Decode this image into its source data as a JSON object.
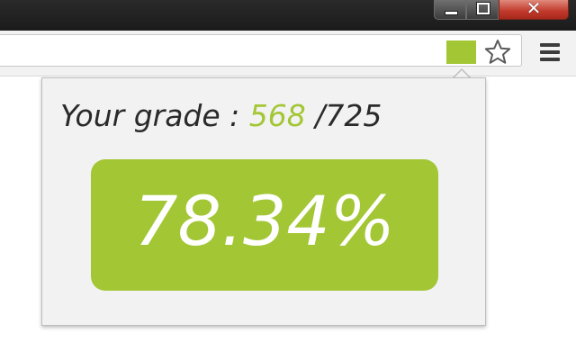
{
  "window": {
    "minimize_icon": "minimize-icon",
    "maximize_icon": "restore-icon",
    "close_icon": "close-icon",
    "close_glyph": "✕"
  },
  "toolbar": {
    "extension_icon": "grade-extension-icon",
    "extension_color": "#a3c635",
    "bookmark_icon": "star-icon",
    "menu_icon": "hamburger-menu-icon"
  },
  "popup": {
    "grade_prefix": "Your grade : ",
    "grade_score": "568",
    "grade_total": " /725",
    "percentage": "78.34%",
    "accent_color": "#a3c635"
  }
}
